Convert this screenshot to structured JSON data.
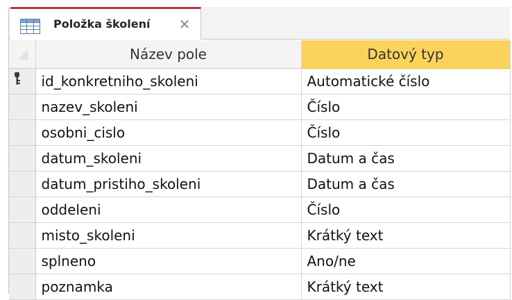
{
  "tab": {
    "title": "Položka školení",
    "icon": "table-icon",
    "close_icon": "close-icon"
  },
  "columns": {
    "field_name": "Název pole",
    "data_type": "Datový typ"
  },
  "rows": [
    {
      "name": "id_konkretniho_skoleni",
      "type": "Automatické číslo",
      "primary_key": true
    },
    {
      "name": "nazev_skoleni",
      "type": "Číslo"
    },
    {
      "name": "osobni_cislo",
      "type": "Číslo"
    },
    {
      "name": "datum_skoleni",
      "type": "Datum a čas"
    },
    {
      "name": "datum_pristiho_skoleni",
      "type": "Datum a čas"
    },
    {
      "name": "oddeleni",
      "type": "Číslo"
    },
    {
      "name": "misto_skoleni",
      "type": "Krátký text"
    },
    {
      "name": "splneno",
      "type": "Ano/ne"
    },
    {
      "name": "poznamka",
      "type": "Krátký text"
    }
  ],
  "colors": {
    "tab_accent": "#b03a48",
    "selected_column_header": "#fbd35c"
  }
}
